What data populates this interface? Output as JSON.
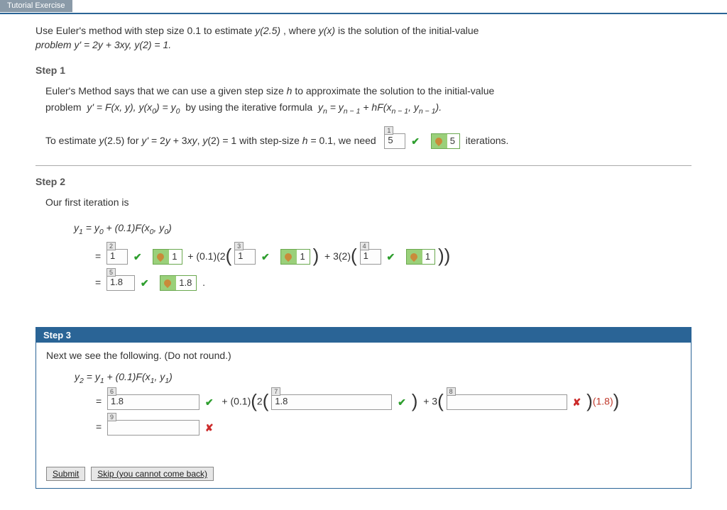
{
  "tab_label": "Tutorial Exercise",
  "problem": {
    "line1_a": "Use Euler's method with step size 0.1 to estimate ",
    "y_target": "y(2.5)",
    "line1_b": ", where ",
    "yx": "y(x)",
    "line1_c": " is the solution of the initial-value",
    "line2": "problem y' = 2y + 3xy, y(2) = 1."
  },
  "step1": {
    "heading": "Step 1",
    "text_a": "Euler's Method says that we can use a given step size ",
    "h": "h",
    "text_b": " to approximate the solution to the initial-value",
    "text_c": "problem  y' = F(x, y), y(x₀) = y₀  by using the iterative formula  yₙ = yₙ ₋ ₁ + hF(xₙ ₋ ₁, yₙ ₋ ₁).",
    "line2_a": "To estimate y(2.5) for y' = 2y + 3xy, y(2) = 1 with step-size h = 0.1, we need",
    "input": {
      "num": "1",
      "value": "5"
    },
    "soln_value": "5",
    "iter_label": "iterations."
  },
  "step2": {
    "heading": "Step 2",
    "intro": "Our first iteration is",
    "eq_head": "y₁ = y₀ + (0.1)F(x₀, y₀)",
    "row1": {
      "in2": {
        "num": "2",
        "value": "1"
      },
      "s2": "1",
      "mid1": "+ (0.1)(2",
      "in3": {
        "num": "3",
        "value": "1"
      },
      "s3": "1",
      "mid2": "+ 3(2)",
      "in4": {
        "num": "4",
        "value": "1"
      },
      "s4": "1"
    },
    "row2": {
      "in5": {
        "num": "5",
        "value": "1.8"
      },
      "s5": "1.8"
    }
  },
  "step3": {
    "heading": "Step 3",
    "intro": "Next we see the following. (Do not round.)",
    "eq_head": "y₂ = y₁ + (0.1)F(x₁, y₁)",
    "row1": {
      "in6": {
        "num": "6",
        "value": "1.8"
      },
      "mid1": "+ (0.1)",
      "in7": {
        "num": "7",
        "value": "1.8"
      },
      "mid2": "+ 3",
      "in8": {
        "num": "8",
        "value": ""
      },
      "note": "(1.8)"
    },
    "row2": {
      "in9": {
        "num": "9",
        "value": ""
      }
    },
    "submit": "Submit",
    "skip": "Skip (you cannot come back)"
  }
}
